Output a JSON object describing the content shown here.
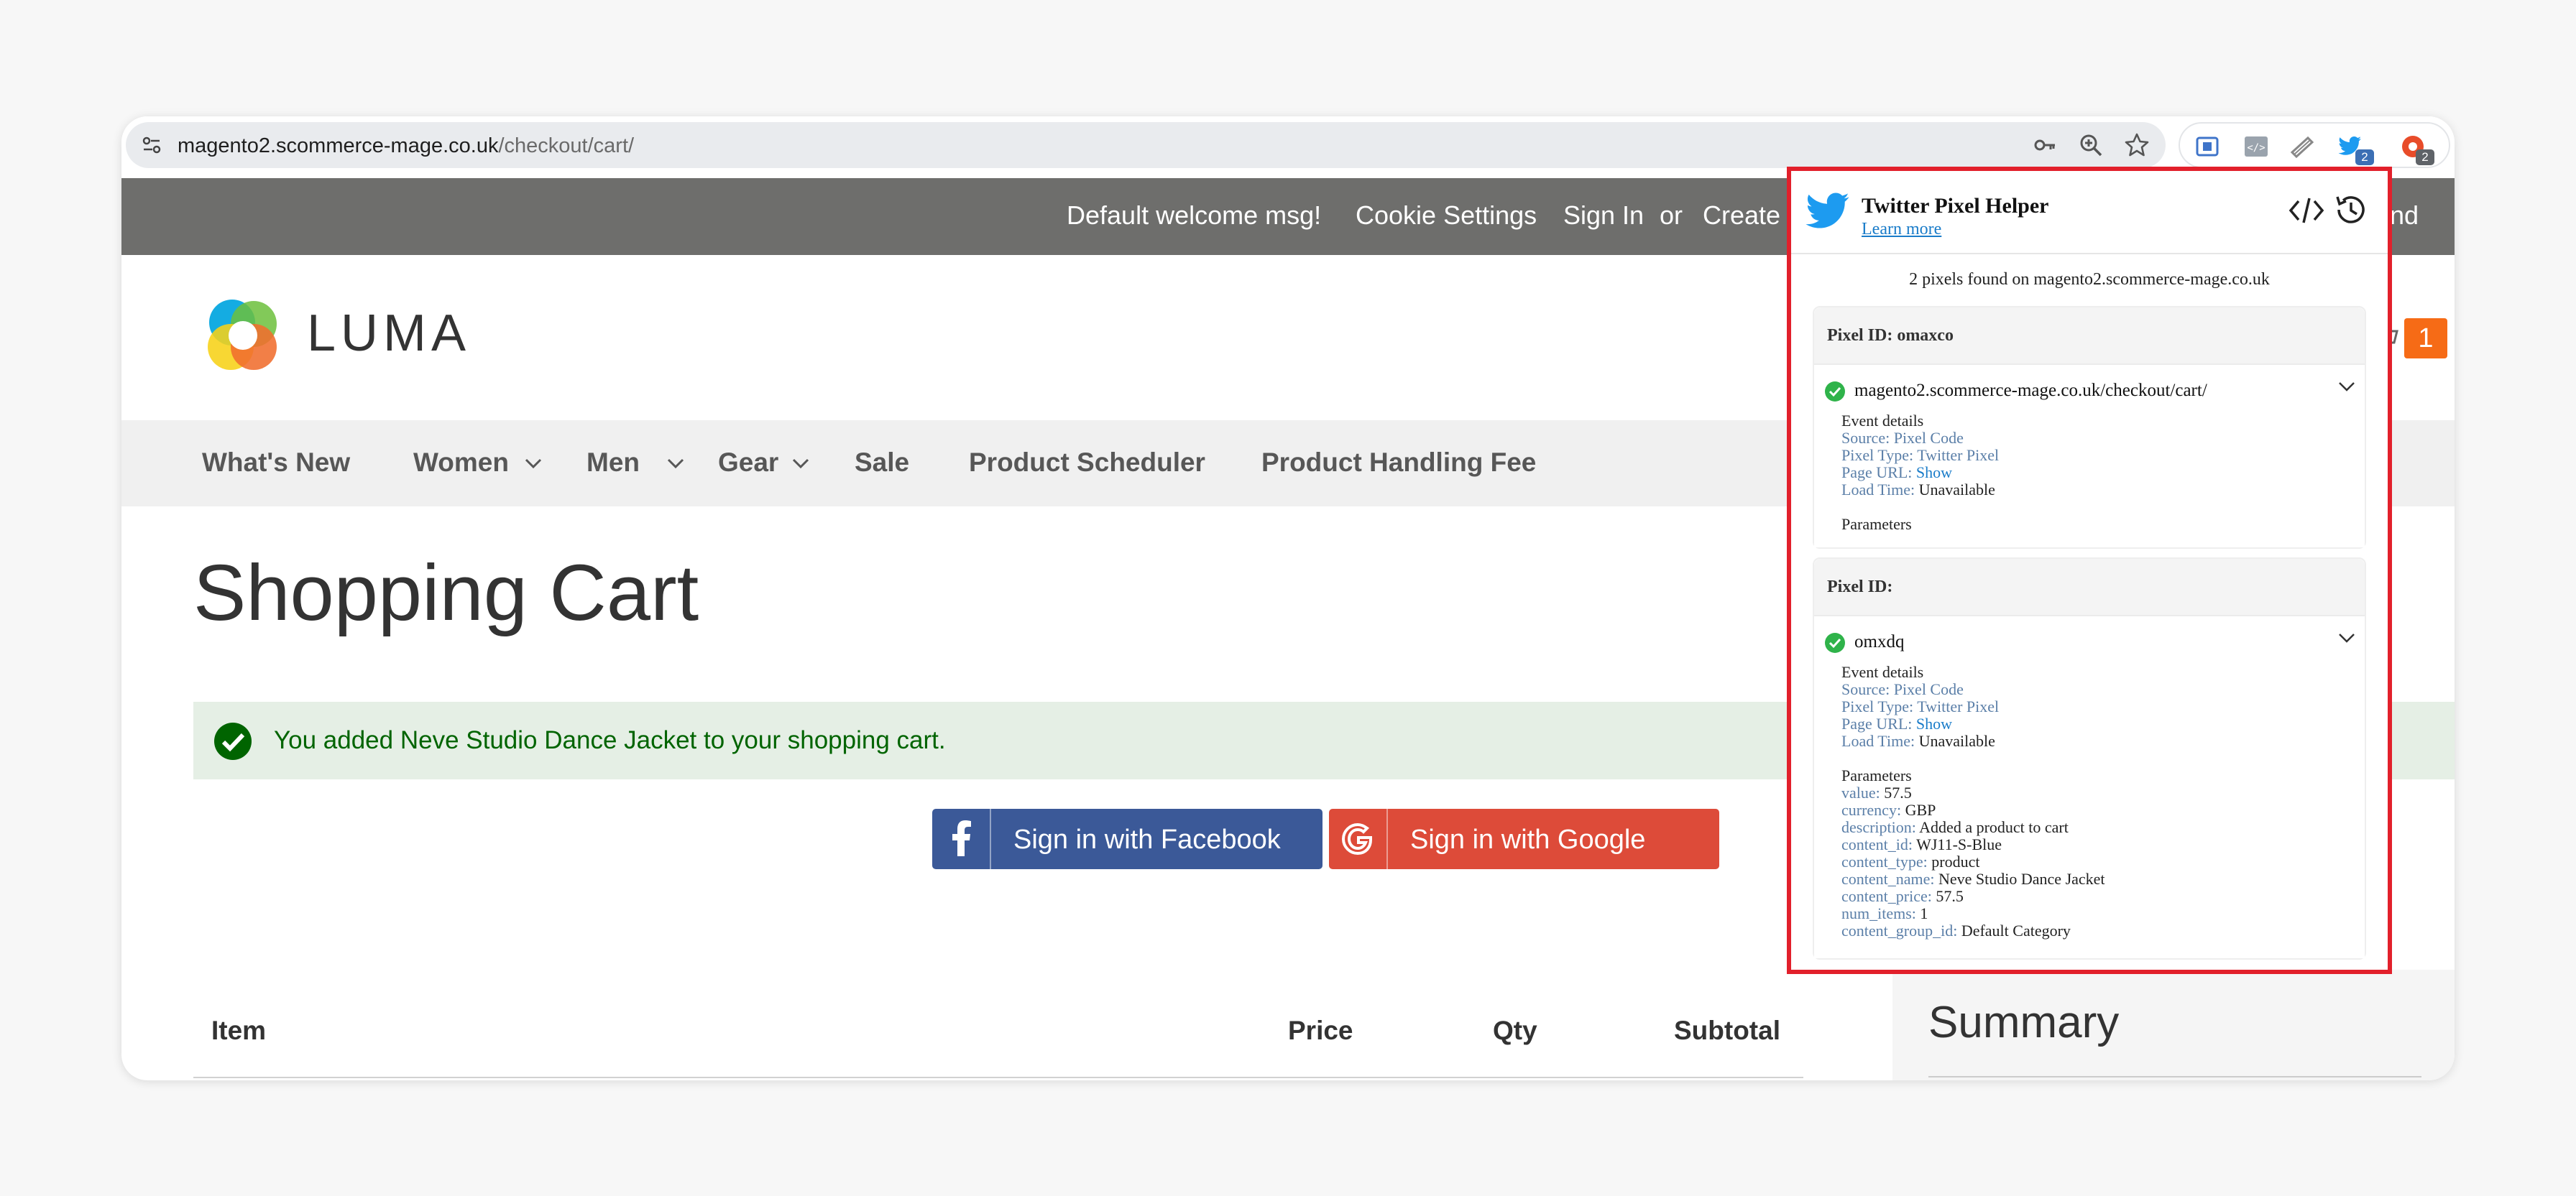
{
  "browser": {
    "url_host": "magento2.scommerce-mage.co.uk",
    "url_path": "/checkout/cart/",
    "twitter_badge": "2",
    "other_badge": "2"
  },
  "topbar": {
    "welcome": "Default welcome msg!",
    "cookie": "Cookie Settings",
    "signin": "Sign In",
    "or": "or",
    "create": "Create",
    "currency_partial": "und"
  },
  "logo": {
    "text": "LUMA"
  },
  "cart": {
    "count": "1"
  },
  "nav": {
    "items": [
      "What's New",
      "Women",
      "Men",
      "Gear",
      "Sale",
      "Product Scheduler",
      "Product Handling Fee"
    ]
  },
  "page": {
    "title": "Shopping Cart",
    "message": "You added Neve Studio Dance Jacket to your shopping cart.",
    "facebook_btn": "Sign in with Facebook",
    "google_btn": "Sign in with Google"
  },
  "table": {
    "headers": [
      "Item",
      "Price",
      "Qty",
      "Subtotal"
    ]
  },
  "summary": {
    "title": "Summary"
  },
  "popup": {
    "title": "Twitter Pixel Helper",
    "learn_more": "Learn more",
    "summary": "2 pixels found on magento2.scommerce-mage.co.uk",
    "pixels": [
      {
        "id_label": "Pixel ID: omaxco",
        "url": "magento2.scommerce-mage.co.uk/checkout/cart/",
        "event_details": "Event details",
        "source_k": "Source:",
        "source_v": "Pixel Code",
        "type_k": "Pixel Type:",
        "type_v": "Twitter Pixel",
        "page_url_k": "Page URL:",
        "page_url_v": "Show",
        "load_k": "Load Time:",
        "load_v": "Unavailable",
        "params_label": "Parameters"
      },
      {
        "id_label": "Pixel ID:",
        "url": "omxdq",
        "event_details": "Event details",
        "source_k": "Source:",
        "source_v": "Pixel Code",
        "type_k": "Pixel Type:",
        "type_v": "Twitter Pixel",
        "page_url_k": "Page URL:",
        "page_url_v": "Show",
        "load_k": "Load Time:",
        "load_v": "Unavailable",
        "params_label": "Parameters",
        "params": [
          {
            "k": "value:",
            "v": "57.5"
          },
          {
            "k": "currency:",
            "v": "GBP"
          },
          {
            "k": "description:",
            "v": "Added a product to cart"
          },
          {
            "k": "content_id:",
            "v": "WJ11-S-Blue"
          },
          {
            "k": "content_type:",
            "v": "product"
          },
          {
            "k": "content_name:",
            "v": "Neve Studio Dance Jacket"
          },
          {
            "k": "content_price:",
            "v": "57.5"
          },
          {
            "k": "num_items:",
            "v": "1"
          },
          {
            "k": "content_group_id:",
            "v": "Default Category"
          }
        ]
      }
    ]
  },
  "colors": {
    "topbar": "#6e6e6c",
    "nav_bg": "#f0f0f0",
    "facebook": "#3b5998",
    "google": "#dd4b39",
    "highlight_border": "#e2202b",
    "twitter_blue": "#1d9bf0",
    "cart_badge": "#f66b16",
    "success_bg": "#e5efe5",
    "success_text": "#006400"
  },
  "icons": [
    "site-info-icon",
    "key-icon",
    "zoom-icon",
    "star-icon",
    "extension-icons",
    "twitter-bird-icon",
    "code-icon",
    "history-icon",
    "check-icon",
    "chevron-down-icon",
    "facebook-icon",
    "google-icon"
  ]
}
